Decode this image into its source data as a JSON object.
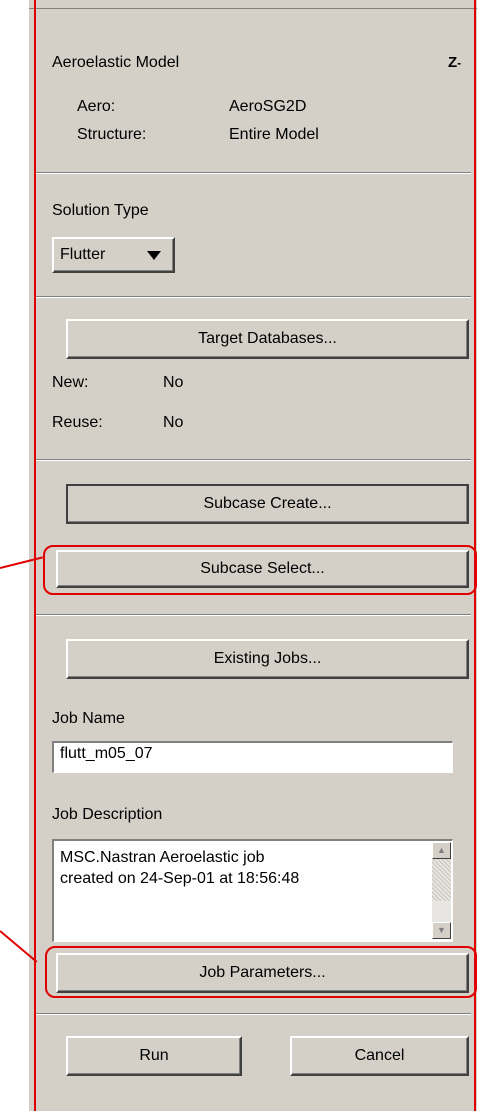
{
  "model": {
    "heading": "Aeroelastic Model",
    "aero_label": "Aero:",
    "aero_value": "AeroSG2D",
    "structure_label": "Structure:",
    "structure_value": "Entire Model"
  },
  "solution": {
    "label": "Solution Type",
    "selected": "Flutter"
  },
  "target": {
    "button": "Target Databases...",
    "new_label": "New:",
    "new_value": "No",
    "reuse_label": "Reuse:",
    "reuse_value": "No"
  },
  "subcase": {
    "create": "Subcase Create...",
    "select": "Subcase Select..."
  },
  "jobs": {
    "existing": "Existing Jobs...",
    "name_label": "Job Name",
    "name_value": "flutt_m05_07",
    "desc_label": "Job Description",
    "desc_line1": "MSC.Nastran Aeroelastic job",
    "desc_line2": "created on 24-Sep-01 at 18:56:48",
    "parameters": "Job Parameters..."
  },
  "actions": {
    "run": "Run",
    "cancel": "Cancel"
  },
  "icons": {
    "toggle": "z-toggle-icon",
    "dropdown": "triangle-down-icon"
  },
  "colors": {
    "panel": "#d4d0c8",
    "callout": "#e00000"
  }
}
